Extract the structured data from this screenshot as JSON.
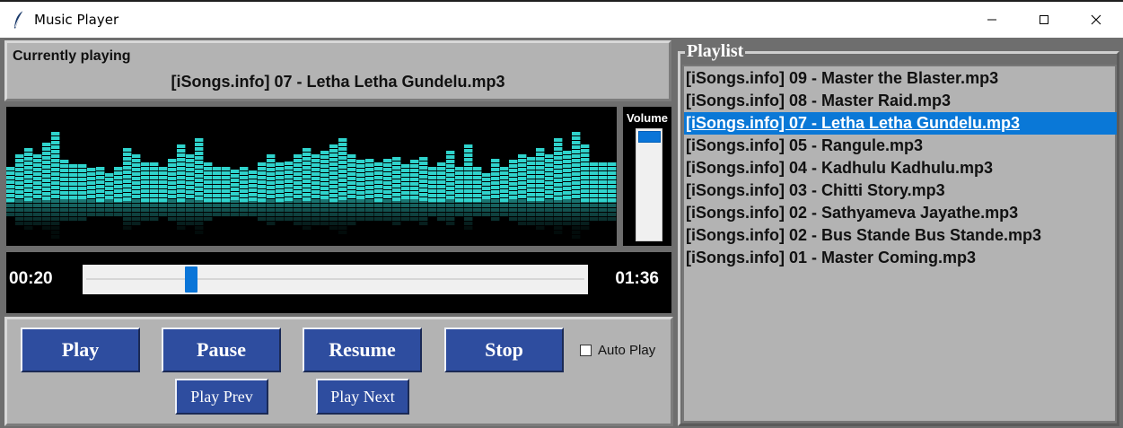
{
  "window": {
    "title": "Music Player",
    "icon": "feather-icon",
    "controls": [
      "minimize-icon",
      "maximize-icon",
      "close-icon"
    ]
  },
  "now_playing": {
    "label": "Currently playing",
    "song": "[iSongs.info] 07 - Letha Letha Gundelu.mp3"
  },
  "visualizer": {
    "bar_color": "#2fd3cc",
    "levels": [
      0.48,
      0.66,
      0.76,
      0.66,
      0.84,
      1.0,
      0.58,
      0.52,
      0.52,
      0.46,
      0.48,
      0.38,
      0.48,
      0.76,
      0.66,
      0.54,
      0.54,
      0.48,
      0.6,
      0.82,
      0.66,
      0.9,
      0.54,
      0.48,
      0.48,
      0.44,
      0.48,
      0.42,
      0.54,
      0.66,
      0.54,
      0.56,
      0.66,
      0.76,
      0.66,
      0.72,
      0.82,
      0.9,
      0.66,
      0.58,
      0.6,
      0.54,
      0.6,
      0.62,
      0.52,
      0.58,
      0.62,
      0.48,
      0.54,
      0.72,
      0.48,
      0.82,
      0.48,
      0.38,
      0.6,
      0.48,
      0.58,
      0.66,
      0.62,
      0.76,
      0.66,
      0.9,
      0.72,
      1.0,
      0.82,
      0.54,
      0.54,
      0.54
    ]
  },
  "volume": {
    "label": "Volume",
    "level": 1.0,
    "accent": "#0a75d8"
  },
  "seek": {
    "current_time": "00:20",
    "total_time": "01:36",
    "position": 0.208
  },
  "controls": {
    "play": "Play",
    "pause": "Pause",
    "resume": "Resume",
    "stop": "Stop",
    "prev": "Play Prev",
    "next": "Play Next",
    "autoplay_label": "Auto Play",
    "autoplay_checked": false,
    "button_color": "#2e4d9f"
  },
  "playlist": {
    "title": "Playlist",
    "selected_index": 2,
    "items": [
      "[iSongs.info] 09 - Master the Blaster.mp3",
      "[iSongs.info] 08 - Master Raid.mp3",
      "[iSongs.info] 07 - Letha Letha Gundelu.mp3",
      "[iSongs.info] 05 - Rangule.mp3",
      "[iSongs.info] 04 - Kadhulu Kadhulu.mp3",
      "[iSongs.info] 03 - Chitti Story.mp3",
      "[iSongs.info] 02 - Sathyameva Jayathe.mp3",
      "[iSongs.info] 02 - Bus Stande Bus Stande.mp3",
      "[iSongs.info] 01 - Master Coming.mp3"
    ]
  }
}
